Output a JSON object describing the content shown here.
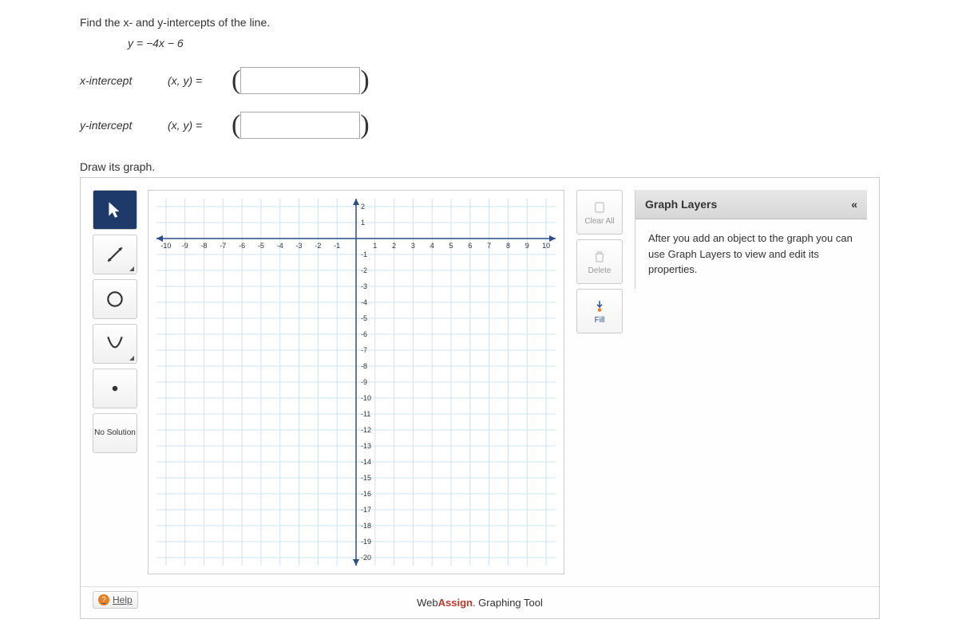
{
  "question": {
    "prompt": "Find the x- and y-intercepts of the line.",
    "equation": "y = −4x − 6",
    "rows": [
      {
        "label": "x-intercept",
        "eq": "(x, y)  ="
      },
      {
        "label": "y-intercept",
        "eq": "(x, y)  ="
      }
    ],
    "draw_label": "Draw its graph."
  },
  "tools": {
    "pointer": "Pointer",
    "line": "Line",
    "circle": "Circle",
    "parabola": "Parabola",
    "point": "Point",
    "no_solution": "No Solution"
  },
  "actions": {
    "clear_all": "Clear All",
    "delete": "Delete",
    "fill": "Fill"
  },
  "help_label": "Help",
  "layers": {
    "title": "Graph Layers",
    "body": "After you add an object to the graph you can use Graph Layers to view and edit its properties."
  },
  "chart_data": {
    "type": "scatter",
    "title": "",
    "xlabel": "",
    "ylabel": "",
    "x_ticks": [
      -10,
      -9,
      -8,
      -7,
      -6,
      -5,
      -4,
      -3,
      -2,
      -1,
      1,
      2,
      3,
      4,
      5,
      6,
      7,
      8,
      9,
      10
    ],
    "y_ticks": [
      2,
      1,
      -1,
      -2,
      -3,
      -4,
      -5,
      -6,
      -7,
      -8,
      -9,
      -10,
      -11,
      -12,
      -13,
      -14,
      -15,
      -16,
      -17,
      -18,
      -19,
      -20
    ],
    "xlim": [
      -10.5,
      10.5
    ],
    "ylim": [
      -20.5,
      2.5
    ],
    "series": []
  },
  "footer": {
    "brand_pre": "Web",
    "brand_em": "Assign",
    "brand_post": ". Graphing Tool"
  }
}
